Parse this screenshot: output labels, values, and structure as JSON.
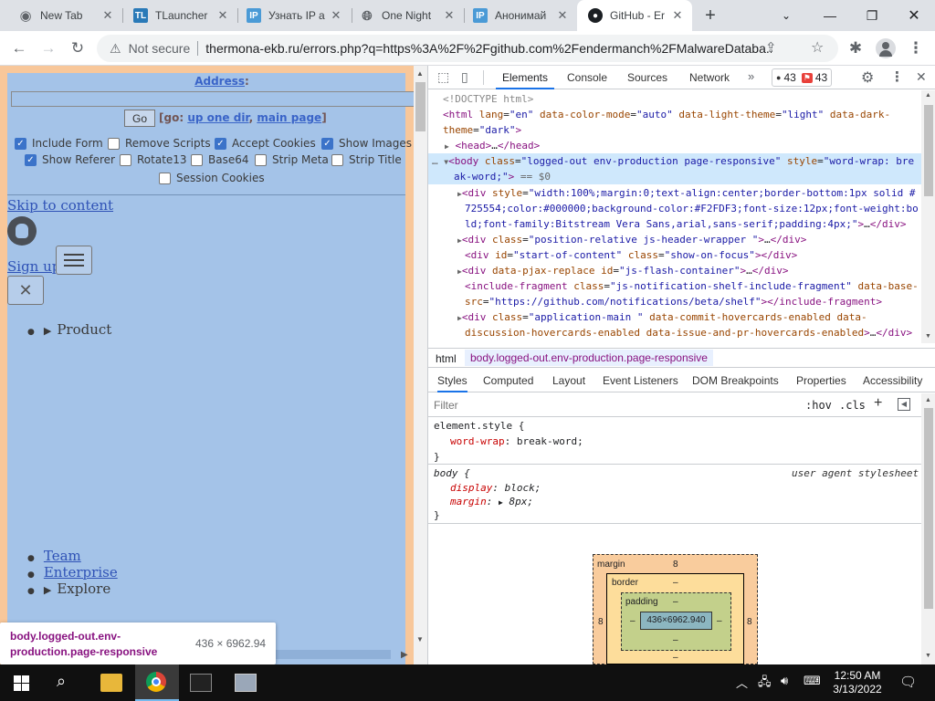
{
  "tabs": [
    {
      "title": "New Tab",
      "fav": "chrome-icon"
    },
    {
      "title": "TLauncher",
      "fav": "TL"
    },
    {
      "title": "Узнать IP а",
      "fav": "IP"
    },
    {
      "title": "One Night",
      "fav": "globe-icon"
    },
    {
      "title": "Анонимай",
      "fav": "IP"
    },
    {
      "title": "GitHub - Er",
      "fav": "github-icon"
    }
  ],
  "toolbar": {
    "not_secure": "Not secure",
    "url": "thermona-ekb.ru/errors.php?q=https%3A%2F%2Fgithub.com%2Fendermanch%2FMalwareDataba..."
  },
  "proxy": {
    "address_label": "Address",
    "go_label": "Go",
    "go_prefix": "[go:",
    "up_one_dir": "up one dir",
    "main_page": "main page",
    "go_suffix": "]",
    "comma": ",",
    "options": [
      {
        "label": "Include Form",
        "checked": true
      },
      {
        "label": "Remove Scripts",
        "checked": false
      },
      {
        "label": "Accept Cookies",
        "checked": true
      },
      {
        "label": "Show Images",
        "checked": true
      },
      {
        "label": "Show Referer",
        "checked": true
      },
      {
        "label": "Rotate13",
        "checked": false
      },
      {
        "label": "Base64",
        "checked": false
      },
      {
        "label": "Strip Meta",
        "checked": false
      },
      {
        "label": "Strip Title",
        "checked": false
      },
      {
        "label": "Session Cookies",
        "checked": false
      }
    ]
  },
  "page": {
    "skip": "Skip to content",
    "signup": "Sign up",
    "product": "Product",
    "team": "Team",
    "enterprise": "Enterprise",
    "explore": "Explore"
  },
  "tooltip": {
    "selector": "body.logged-out.env-production.page-responsive",
    "size": "436 × 6962.94"
  },
  "devtools": {
    "tabs": [
      "Elements",
      "Console",
      "Sources",
      "Network"
    ],
    "errors": "43",
    "warnings": "43",
    "subtabs": [
      "Styles",
      "Computed",
      "Layout",
      "Event Listeners",
      "DOM Breakpoints",
      "Properties",
      "Accessibility"
    ],
    "filter_placeholder": "Filter",
    "hov": ":hov",
    "cls": ".cls",
    "crumb_html": "html",
    "crumb_body": "body.logged-out.env-production.page-responsive",
    "styles": {
      "rule1_sel": "element.style {",
      "rule1_prop": "word-wrap",
      "rule1_val": "break-word;",
      "rule2_sel": "body {",
      "rule2_src": "user agent stylesheet",
      "rule2_prop1": "display",
      "rule2_val1": "block;",
      "rule2_prop2": "margin",
      "rule2_val2": "8px;",
      "close": "}"
    },
    "boxmodel": {
      "margin_label": "margin",
      "margin_val": "8",
      "border_label": "border",
      "border_val": "–",
      "padding_label": "padding",
      "padding_val": "–",
      "content": "436×6962.940",
      "side": "8",
      "dash": "–"
    }
  },
  "taskbar": {
    "time": "12:50 AM",
    "date": "3/13/2022"
  }
}
